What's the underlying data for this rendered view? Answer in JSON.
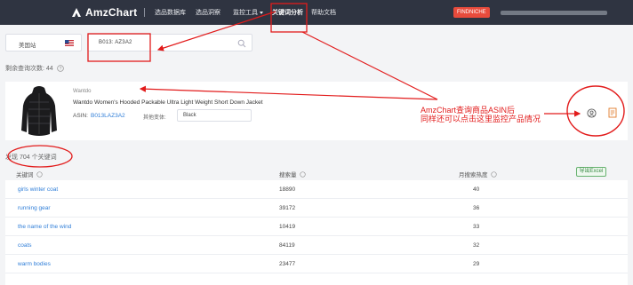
{
  "nav": {
    "logo": "AmzChart",
    "items": [
      "选品数据库",
      "选品洞察",
      "监控工具",
      "关键词分析",
      "帮助文档"
    ],
    "findniche": "FINDNICHE"
  },
  "search": {
    "market": "美国站",
    "value": "B013: AZ3A2"
  },
  "remaining": "剩余查询次数: 44",
  "product": {
    "brand": "Wantdo",
    "title": "Wantdo Women's Hooded Packable Ultra Light Weight Short Down Jacket",
    "asin_label": "ASIN:",
    "asin": "B013LAZ3A2",
    "variant_label": "其他变体:",
    "variant_value": "Black"
  },
  "found": "发现 704 个关键词",
  "table": {
    "headers": [
      "关键词",
      "搜索量",
      "月搜索热度"
    ],
    "export_label": "导出Excel",
    "rows": [
      {
        "keyword": "girls winter coat",
        "volume": "18890",
        "rank": "40"
      },
      {
        "keyword": "running gear",
        "volume": "39172",
        "rank": "36"
      },
      {
        "keyword": "the name of the wind",
        "volume": "10419",
        "rank": "33"
      },
      {
        "keyword": "coats",
        "volume": "84119",
        "rank": "32"
      },
      {
        "keyword": "warm bodies",
        "volume": "23477",
        "rank": "29"
      }
    ]
  },
  "annotation": {
    "line1": "AmzChart查询商品ASIN后",
    "line2": "同样还可以点击这里监控产品情况",
    "color": "#e21b1b"
  },
  "colors": {
    "nav_bg": "#2f3441",
    "link": "#2f7ed8",
    "findniche": "#e84b3c",
    "export": "#3a8a44"
  }
}
